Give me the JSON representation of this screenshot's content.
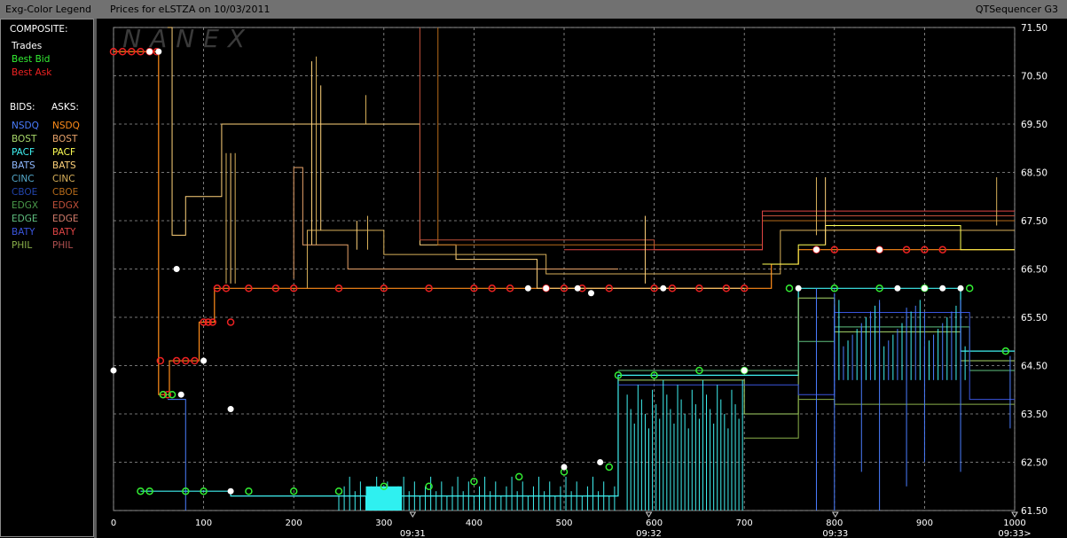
{
  "title_bar": {
    "legend_title": "Exg-Color Legend",
    "chart_title": "Prices for  eLSTZA  on  10/03/2011",
    "app_name": "QTSequencer G3"
  },
  "legend": {
    "composite_header": "COMPOSITE:",
    "composite": [
      {
        "label": "Trades",
        "color": "#ffffff"
      },
      {
        "label": "Best Bid",
        "color": "#33ee33"
      },
      {
        "label": "Best Ask",
        "color": "#ee2222"
      }
    ],
    "bids_header": "BIDS:",
    "asks_header": "ASKS:",
    "bids": [
      {
        "label": "NSDQ",
        "color": "#4a7dff"
      },
      {
        "label": "BOST",
        "color": "#a8d86a"
      },
      {
        "label": "PACF",
        "color": "#3ff0f0"
      },
      {
        "label": "BATS",
        "color": "#8fb8ff"
      },
      {
        "label": "CINC",
        "color": "#55aacc"
      },
      {
        "label": "CBOE",
        "color": "#2244aa"
      },
      {
        "label": "EDGX",
        "color": "#4a9a4a"
      },
      {
        "label": "EDGE",
        "color": "#5fbf7f"
      },
      {
        "label": "BATY",
        "color": "#3a55dd"
      },
      {
        "label": "PHIL",
        "color": "#8ab04a"
      }
    ],
    "asks": [
      {
        "label": "NSDQ",
        "color": "#ff8c1a"
      },
      {
        "label": "BOST",
        "color": "#e8a36a"
      },
      {
        "label": "PACF",
        "color": "#ffff55"
      },
      {
        "label": "BATS",
        "color": "#ffd27a"
      },
      {
        "label": "CINC",
        "color": "#d8b05a"
      },
      {
        "label": "CBOE",
        "color": "#b56a1a"
      },
      {
        "label": "EDGX",
        "color": "#c0503a"
      },
      {
        "label": "EDGE",
        "color": "#d07a6a"
      },
      {
        "label": "BATY",
        "color": "#dd4444"
      },
      {
        "label": "PHIL",
        "color": "#b05050"
      }
    ]
  },
  "watermark": "NANEX",
  "chart_data": {
    "type": "line",
    "title": "Prices for  eLSTZA  on  10/03/2011",
    "x_range": [
      0,
      1000
    ],
    "y_range": [
      61.5,
      71.5
    ],
    "x_ticks": [
      0,
      100,
      200,
      300,
      400,
      500,
      600,
      700,
      800,
      900,
      1000
    ],
    "y_ticks": [
      "71.50",
      "70.50",
      "69.50",
      "68.50",
      "67.50",
      "66.50",
      "65.50",
      "64.50",
      "63.50",
      "62.50",
      "61.50"
    ],
    "time_ticks": [
      {
        "x": 332,
        "label": "09:31"
      },
      {
        "x": 594,
        "label": "09:32"
      },
      {
        "x": 801,
        "label": "09:33"
      },
      {
        "x": 1000,
        "label": "09:33>"
      }
    ],
    "grid": true,
    "series": [
      {
        "name": "Best Ask",
        "color": "#ee2222",
        "marker": "open-circle",
        "points": [
          [
            0,
            71.0
          ],
          [
            10,
            71.0
          ],
          [
            20,
            71.0
          ],
          [
            30,
            71.0
          ],
          [
            40,
            71.0
          ],
          [
            48,
            71.0
          ],
          [
            52,
            64.6
          ],
          [
            55,
            63.9
          ],
          [
            60,
            63.9
          ],
          [
            70,
            64.6
          ],
          [
            80,
            64.6
          ],
          [
            90,
            64.6
          ],
          [
            100,
            65.4
          ],
          [
            105,
            65.4
          ],
          [
            110,
            65.4
          ],
          [
            115,
            66.1
          ],
          [
            125,
            66.1
          ],
          [
            130,
            65.4
          ],
          [
            150,
            66.1
          ],
          [
            180,
            66.1
          ],
          [
            200,
            66.1
          ],
          [
            250,
            66.1
          ],
          [
            300,
            66.1
          ],
          [
            350,
            66.1
          ],
          [
            400,
            66.1
          ],
          [
            420,
            66.1
          ],
          [
            440,
            66.1
          ],
          [
            480,
            66.1
          ],
          [
            500,
            66.1
          ],
          [
            520,
            66.1
          ],
          [
            550,
            66.1
          ],
          [
            600,
            66.1
          ],
          [
            620,
            66.1
          ],
          [
            650,
            66.1
          ],
          [
            680,
            66.1
          ],
          [
            700,
            66.1
          ],
          [
            780,
            66.9
          ],
          [
            800,
            66.9
          ],
          [
            850,
            66.9
          ],
          [
            880,
            66.9
          ],
          [
            900,
            66.9
          ],
          [
            920,
            66.9
          ]
        ]
      },
      {
        "name": "Best Bid",
        "color": "#33ee33",
        "marker": "open-circle",
        "points": [
          [
            30,
            61.9
          ],
          [
            40,
            61.9
          ],
          [
            55,
            63.9
          ],
          [
            65,
            63.9
          ],
          [
            80,
            61.9
          ],
          [
            100,
            61.9
          ],
          [
            150,
            61.9
          ],
          [
            200,
            61.9
          ],
          [
            250,
            61.9
          ],
          [
            300,
            62.0
          ],
          [
            350,
            62.0
          ],
          [
            400,
            62.1
          ],
          [
            450,
            62.2
          ],
          [
            500,
            62.3
          ],
          [
            550,
            62.4
          ],
          [
            560,
            64.3
          ],
          [
            600,
            64.3
          ],
          [
            650,
            64.4
          ],
          [
            700,
            64.4
          ],
          [
            750,
            66.1
          ],
          [
            800,
            66.1
          ],
          [
            850,
            66.1
          ],
          [
            900,
            66.1
          ],
          [
            950,
            66.1
          ],
          [
            990,
            64.8
          ]
        ]
      },
      {
        "name": "Trades",
        "color": "#ffffff",
        "marker": "dot",
        "points": [
          [
            0,
            64.4
          ],
          [
            40,
            71.0
          ],
          [
            50,
            71.0
          ],
          [
            70,
            66.5
          ],
          [
            75,
            63.9
          ],
          [
            100,
            64.6
          ],
          [
            130,
            63.6
          ],
          [
            130,
            61.9
          ],
          [
            460,
            66.1
          ],
          [
            480,
            66.1
          ],
          [
            500,
            62.4
          ],
          [
            515,
            66.1
          ],
          [
            530,
            66.0
          ],
          [
            540,
            62.5
          ],
          [
            610,
            66.1
          ],
          [
            700,
            64.4
          ],
          [
            760,
            66.1
          ],
          [
            780,
            66.9
          ],
          [
            850,
            66.9
          ],
          [
            870,
            66.1
          ],
          [
            900,
            66.1
          ],
          [
            920,
            66.1
          ],
          [
            940,
            66.1
          ]
        ]
      }
    ]
  }
}
